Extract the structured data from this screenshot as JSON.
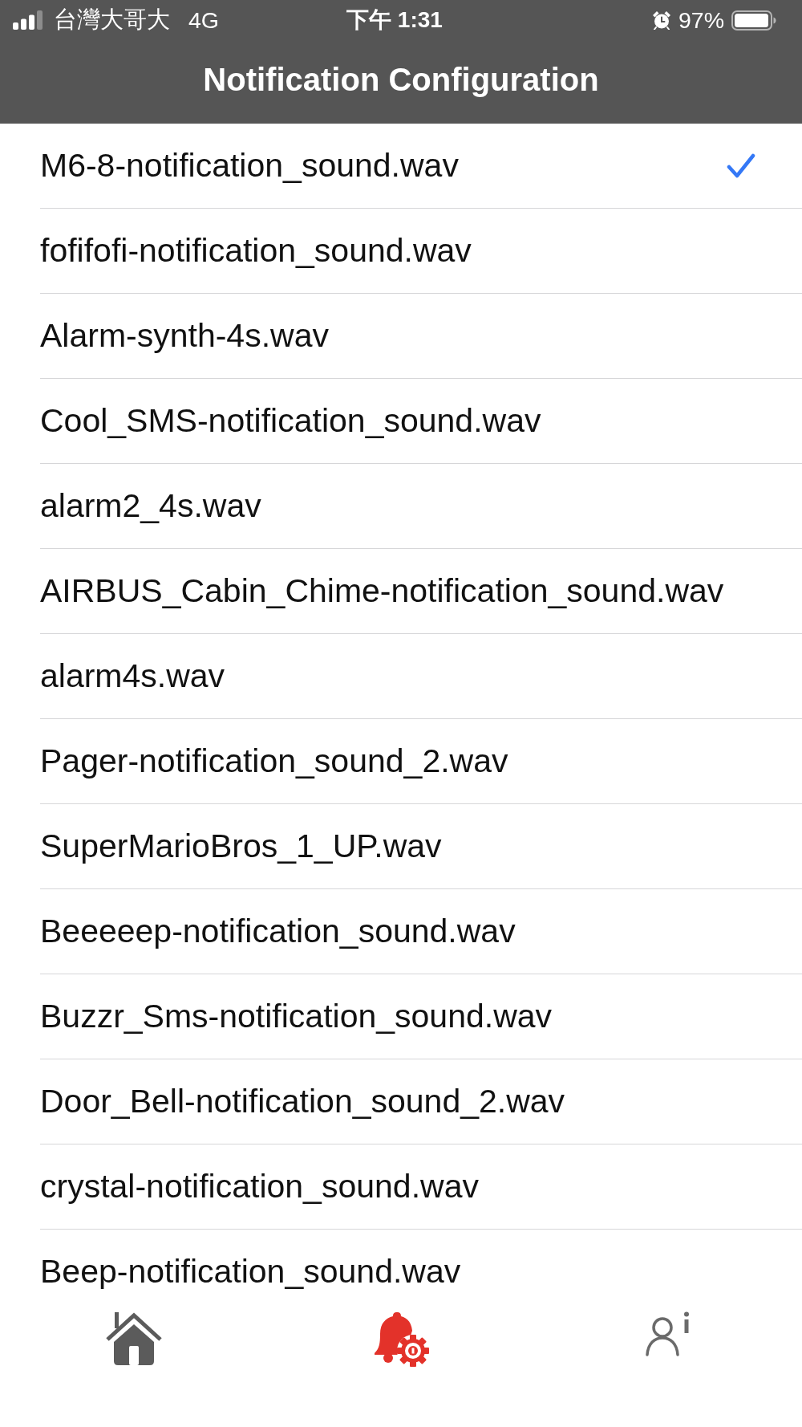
{
  "status_bar": {
    "carrier": "台灣大哥大",
    "network": "4G",
    "time": "下午 1:31",
    "battery": "97%"
  },
  "header": {
    "title": "Notification Configuration"
  },
  "sounds": [
    {
      "name": "M6-8-notification_sound.wav",
      "selected": true
    },
    {
      "name": "fofifofi-notification_sound.wav",
      "selected": false
    },
    {
      "name": "Alarm-synth-4s.wav",
      "selected": false
    },
    {
      "name": "Cool_SMS-notification_sound.wav",
      "selected": false
    },
    {
      "name": "alarm2_4s.wav",
      "selected": false
    },
    {
      "name": "AIRBUS_Cabin_Chime-notification_sound.wav",
      "selected": false
    },
    {
      "name": "alarm4s.wav",
      "selected": false
    },
    {
      "name": "Pager-notification_sound_2.wav",
      "selected": false
    },
    {
      "name": "SuperMarioBros_1_UP.wav",
      "selected": false
    },
    {
      "name": "Beeeeep-notification_sound.wav",
      "selected": false
    },
    {
      "name": "Buzzr_Sms-notification_sound.wav",
      "selected": false
    },
    {
      "name": "Door_Bell-notification_sound_2.wav",
      "selected": false
    },
    {
      "name": "crystal-notification_sound.wav",
      "selected": false
    },
    {
      "name": "Beep-notification_sound.wav",
      "selected": false
    }
  ],
  "tab_bar": [
    {
      "kind": "home",
      "selected": false
    },
    {
      "kind": "notification-settings",
      "selected": true
    },
    {
      "kind": "profile-info",
      "selected": false
    }
  ]
}
